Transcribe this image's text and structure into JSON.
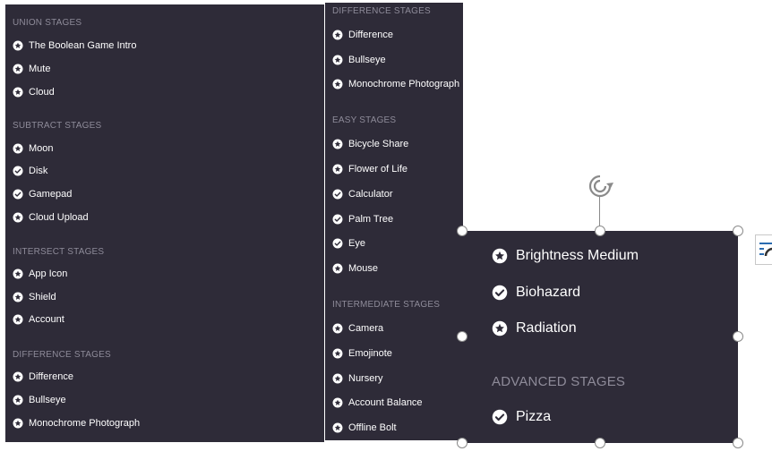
{
  "colors": {
    "panel_bg": "#2e2b38",
    "heading": "#8e8b99",
    "text": "#ffffff",
    "handle_border": "#8a8a8a"
  },
  "panel1": {
    "union_heading": "UNION STAGES",
    "union": [
      {
        "label": "The Boolean Game Intro",
        "icon": "star-circle-icon"
      },
      {
        "label": "Mute",
        "icon": "star-circle-icon"
      },
      {
        "label": "Cloud",
        "icon": "star-circle-icon"
      }
    ],
    "subtract_heading": "SUBTRACT STAGES",
    "subtract": [
      {
        "label": "Moon",
        "icon": "star-circle-icon"
      },
      {
        "label": "Disk",
        "icon": "check-circle-icon"
      },
      {
        "label": "Gamepad",
        "icon": "check-circle-icon"
      },
      {
        "label": "Cloud Upload",
        "icon": "star-circle-icon"
      }
    ],
    "intersect_heading": "INTERSECT STAGES",
    "intersect": [
      {
        "label": "App Icon",
        "icon": "star-circle-icon"
      },
      {
        "label": "Shield",
        "icon": "star-circle-icon"
      },
      {
        "label": "Account",
        "icon": "star-circle-icon"
      }
    ],
    "difference_heading": "DIFFERENCE STAGES",
    "difference": [
      {
        "label": "Difference",
        "icon": "star-circle-icon"
      },
      {
        "label": "Bullseye",
        "icon": "star-circle-icon"
      },
      {
        "label": "Monochrome Photograph",
        "icon": "star-circle-icon"
      }
    ]
  },
  "panel2": {
    "difference_heading": "DIFFERENCE STAGES",
    "difference": [
      {
        "label": "Difference",
        "icon": "star-circle-icon"
      },
      {
        "label": "Bullseye",
        "icon": "star-circle-icon"
      },
      {
        "label": "Monochrome Photograph",
        "icon": "star-circle-icon"
      }
    ],
    "easy_heading": "EASY STAGES",
    "easy": [
      {
        "label": "Bicycle Share",
        "icon": "star-circle-icon"
      },
      {
        "label": "Flower of Life",
        "icon": "star-circle-icon"
      },
      {
        "label": "Calculator",
        "icon": "check-circle-icon"
      },
      {
        "label": "Palm Tree",
        "icon": "check-circle-icon"
      },
      {
        "label": "Eye",
        "icon": "check-circle-icon"
      },
      {
        "label": "Mouse",
        "icon": "star-circle-icon"
      }
    ],
    "intermediate_heading": "INTERMEDIATE STAGES",
    "intermediate": [
      {
        "label": "Camera",
        "icon": "star-circle-icon"
      },
      {
        "label": "Emojinote",
        "icon": "star-circle-icon"
      },
      {
        "label": "Nursery",
        "icon": "star-circle-icon"
      },
      {
        "label": "Account Balance",
        "icon": "star-circle-icon"
      },
      {
        "label": "Offline Bolt",
        "icon": "star-circle-icon"
      }
    ]
  },
  "panel3": {
    "items": [
      {
        "label": "Brightness Medium",
        "icon": "star-circle-icon"
      },
      {
        "label": "Biohazard",
        "icon": "check-circle-icon"
      },
      {
        "label": "Radiation",
        "icon": "star-circle-icon"
      }
    ],
    "advanced_heading": "ADVANCED STAGES",
    "advanced": [
      {
        "label": "Pizza",
        "icon": "check-circle-icon"
      }
    ]
  }
}
